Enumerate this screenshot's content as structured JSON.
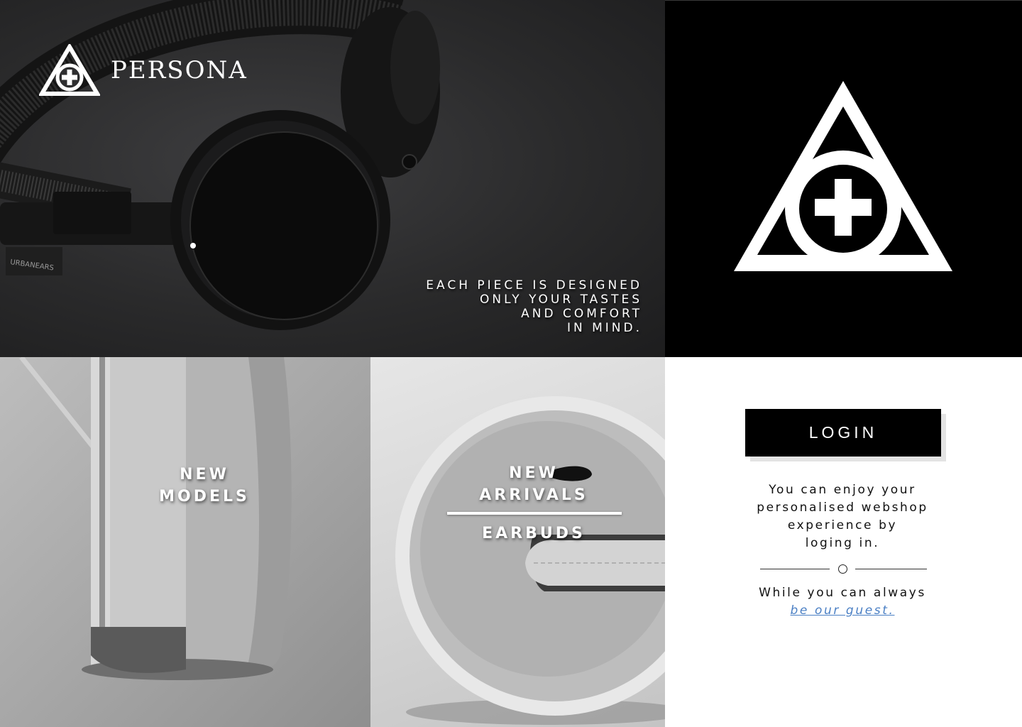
{
  "brand": {
    "name": "PERSONA",
    "logo_icon": "triangle-cross-logo"
  },
  "hero": {
    "tagline_lines": [
      "EACH PIECE IS DESIGNED",
      "ONLY YOUR TASTES",
      "AND COMFORT",
      "IN MIND."
    ],
    "headphone_label": "URBANEARS"
  },
  "products": {
    "models": {
      "lines": [
        "NEW",
        "MODELS"
      ]
    },
    "arrivals": {
      "lines": [
        "NEW",
        "ARRIVALS"
      ],
      "sub_label": "EARBUDS"
    }
  },
  "login": {
    "button_label": "LOGIN",
    "description_lines": [
      "You can enjoy your",
      "personalised webshop",
      "experience by",
      "loging in."
    ],
    "guest_prefix": "While you can always",
    "guest_link": "be our guest."
  },
  "colors": {
    "accent_link": "#4a7fc4",
    "dark": "#000000",
    "light": "#ffffff"
  }
}
